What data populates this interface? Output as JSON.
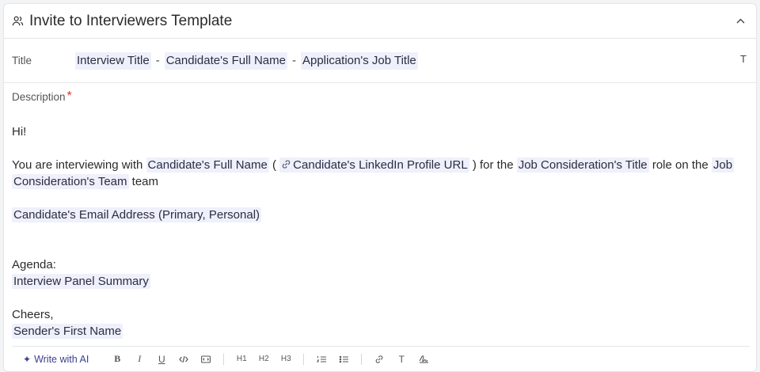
{
  "header": {
    "title": "Invite to Interviewers Template"
  },
  "title_row": {
    "label": "Title",
    "chips": [
      "Interview Title",
      "Candidate's Full Name",
      "Application's Job Title"
    ],
    "separator": "-",
    "text_type_label": "T"
  },
  "description": {
    "label": "Description",
    "required_mark": "*",
    "greeting": "Hi!",
    "intro_text": "You are interviewing with",
    "candidate_name": "Candidate's Full Name",
    "open_paren": "(",
    "linkedin": "Candidate's LinkedIn Profile URL",
    "for_the": ") for the",
    "job_title": "Job Consideration's Title",
    "role_on_the": "role on the",
    "job_team_1": "Job",
    "job_team_2": "Consideration's Team",
    "team_word": "team",
    "email": "Candidate's Email Address (Primary, Personal)",
    "agenda_label": "Agenda:",
    "panel_summary": "Interview Panel Summary",
    "closing": "Cheers,",
    "sender": "Sender's First Name"
  },
  "toolbar": {
    "ai_label": "Write with AI",
    "bold": "B",
    "italic": "I",
    "underline": "U",
    "h1": "H1",
    "h2": "H2",
    "h3": "H3",
    "text": "T"
  }
}
